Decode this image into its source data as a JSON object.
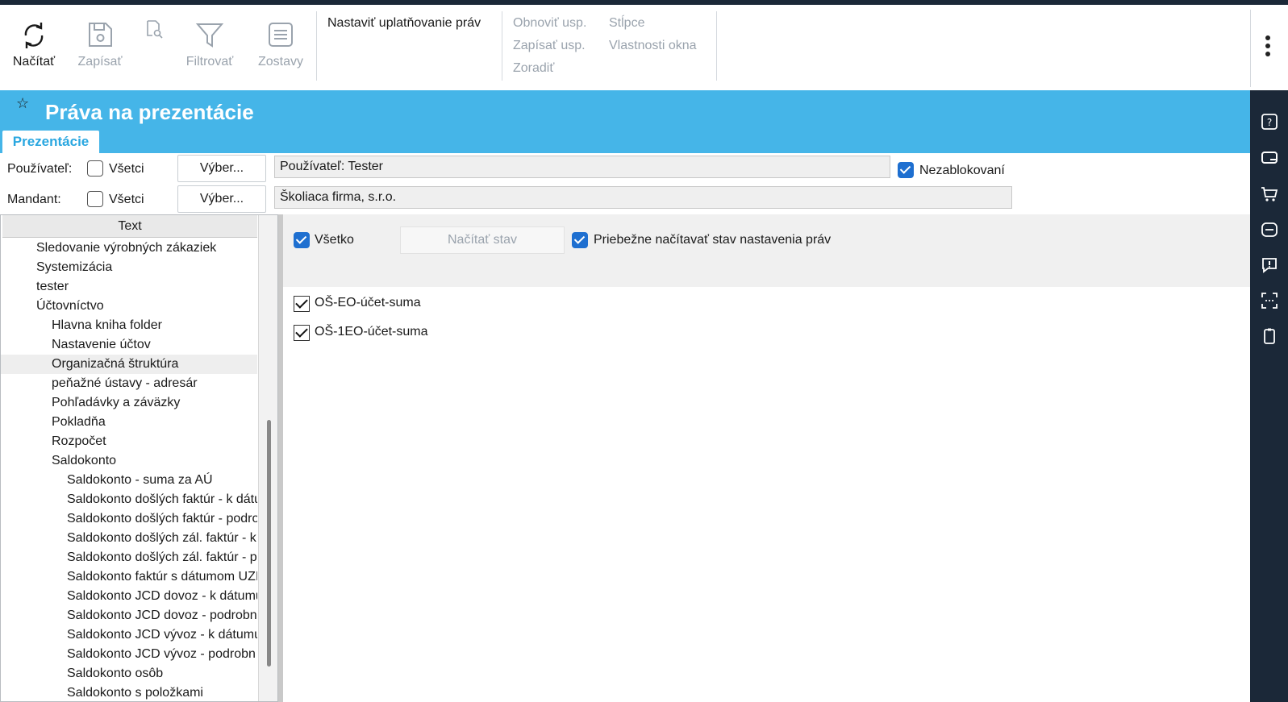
{
  "toolbar": {
    "load": "Načítať",
    "save": "Zapísať",
    "filter": "Filtrovať",
    "reports": "Zostavy",
    "apply_rights": "Nastaviť uplatňovanie práv",
    "refresh_usp": "Obnoviť usp.",
    "write_usp": "Zapísať usp.",
    "sort": "Zoradiť",
    "columns": "Stĺpce",
    "window_props": "Vlastnosti okna"
  },
  "header": {
    "title": "Práva na prezentácie",
    "tab": "Prezentácie"
  },
  "filters": {
    "user_label": "Používateľ:",
    "mandant_label": "Mandant:",
    "all_label": "Všetci",
    "select_button": "Výber...",
    "user_value": "Používateľ: Tester",
    "mandant_value": "Školiaca firma, s.r.o.",
    "unblocked_label": "Nezablokovaní"
  },
  "tree": {
    "column_header": "Text",
    "items": [
      {
        "text": "Sledovanie výrobných zákaziek",
        "level": 1
      },
      {
        "text": "Systemizácia",
        "level": 1
      },
      {
        "text": "tester",
        "level": 1
      },
      {
        "text": "Účtovníctvo",
        "level": 1
      },
      {
        "text": "Hlavna kniha folder",
        "level": 2
      },
      {
        "text": "Nastavenie účtov",
        "level": 2
      },
      {
        "text": "Organizačná štruktúra",
        "level": 2,
        "selected": true
      },
      {
        "text": "peňažné ústavy - adresár",
        "level": 2
      },
      {
        "text": "Pohľadávky a záväzky",
        "level": 2
      },
      {
        "text": "Pokladňa",
        "level": 2
      },
      {
        "text": "Rozpočet",
        "level": 2
      },
      {
        "text": "Saldokonto",
        "level": 2
      },
      {
        "text": "Saldokonto - suma za AÚ",
        "level": 3
      },
      {
        "text": "Saldokonto došlých faktúr - k dátu",
        "level": 3
      },
      {
        "text": "Saldokonto došlých faktúr - podro",
        "level": 3
      },
      {
        "text": "Saldokonto došlých zál. faktúr - k",
        "level": 3
      },
      {
        "text": "Saldokonto došlých zál. faktúr - p",
        "level": 3
      },
      {
        "text": "Saldokonto faktúr s dátumom UZI",
        "level": 3
      },
      {
        "text": "Saldokonto JCD dovoz - k dátumu",
        "level": 3
      },
      {
        "text": "Saldokonto JCD dovoz - podrobn",
        "level": 3
      },
      {
        "text": "Saldokonto JCD vývoz - k dátumu",
        "level": 3
      },
      {
        "text": "Saldokonto JCD vývoz - podrobn",
        "level": 3
      },
      {
        "text": "Saldokonto osôb",
        "level": 3
      },
      {
        "text": "Saldokonto s položkami",
        "level": 3
      }
    ]
  },
  "options": {
    "all_label": "Všetko",
    "load_state": "Načítať stav",
    "continuous_label": "Priebežne načítavať stav nastavenia práv"
  },
  "presentations": [
    {
      "text": "OŠ-EO-účet-suma",
      "checked": true
    },
    {
      "text": "OŠ-1EO-účet-suma",
      "checked": true
    }
  ]
}
